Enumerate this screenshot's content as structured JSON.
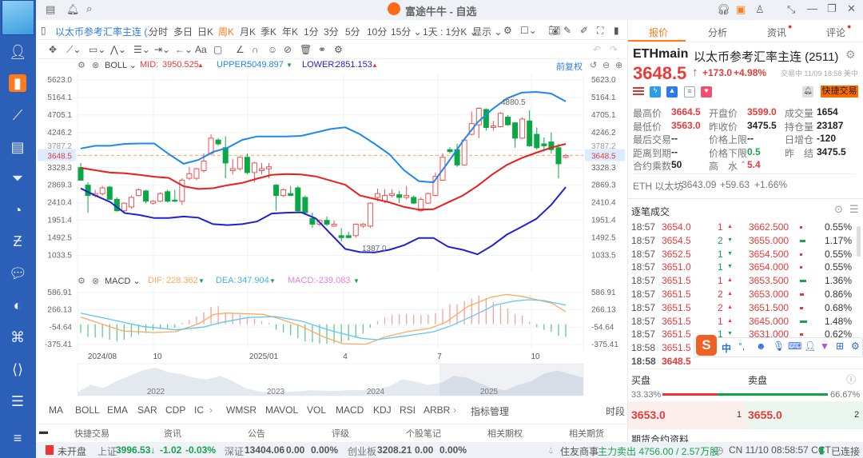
{
  "app": {
    "title": "富途牛牛 - 自选"
  },
  "toolbar1": {
    "symbol": "以太币参考汇率主连 (...",
    "periods": [
      "分时",
      "多日",
      "日K",
      "周K",
      "月K",
      "季K",
      "年K",
      "1分",
      "3分",
      "5分",
      "10分",
      "15分 ⌄",
      "1天 : 1分K ⌄",
      "显示 ⌄"
    ],
    "selected_period": "周K"
  },
  "boll": {
    "name": "BOLL ⌄",
    "mid_label": "MID:",
    "mid": "3950.525",
    "upper_label": "UPPER:",
    "upper": "5049.897",
    "lower_label": "LOWER:",
    "lower": "2851.153",
    "adjust": "前复权"
  },
  "macd": {
    "name": "MACD ⌄",
    "dif_label": "DIF:",
    "dif": "228.362",
    "dea_label": "DEA:",
    "dea": "347.904",
    "macd_label": "MACD:",
    "macd": "-239.083"
  },
  "colors": {
    "up": "#f05050",
    "down": "#0aa845",
    "mid": "#ee1c1c",
    "upper": "#1e88f0",
    "lower": "#1f1fd8",
    "dif": "#ffa85a",
    "dea": "#5ec8f0",
    "accent": "#ff7a1a"
  },
  "chart_data": [
    {
      "type": "candlestick",
      "title": "ETHmain 周K BOLL",
      "y_ticks": [
        "5623.0",
        "5164.1",
        "4705.1",
        "4246.2",
        "3787.2",
        "3328.3",
        "2869.3",
        "2410.4",
        "1951.4",
        "1492.5",
        "1033.5"
      ],
      "ylim": [
        1033.5,
        5623.0
      ],
      "current_price": "3648.5",
      "high_mark": "4880.5",
      "low_mark": "1387.0",
      "ohlc": [
        [
          3330,
          3450,
          2990,
          3000
        ],
        [
          2870,
          2950,
          2150,
          2600
        ],
        [
          2600,
          2750,
          2550,
          2650
        ],
        [
          2650,
          2850,
          2600,
          2800
        ],
        [
          2820,
          2850,
          2480,
          2500
        ],
        [
          2500,
          2550,
          2180,
          2200
        ],
        [
          2200,
          2420,
          2150,
          2400
        ],
        [
          2300,
          2600,
          2250,
          2550
        ],
        [
          2600,
          2780,
          2580,
          2750
        ],
        [
          2720,
          2750,
          2400,
          2450
        ],
        [
          2400,
          2480,
          2360,
          2450
        ],
        [
          2450,
          2680,
          2430,
          2650
        ],
        [
          2700,
          2750,
          2420,
          2450
        ],
        [
          2480,
          2750,
          2430,
          2450
        ],
        [
          2450,
          3050,
          2350,
          3000
        ],
        [
          3050,
          3350,
          3000,
          3170
        ],
        [
          3050,
          3320,
          3000,
          3300
        ],
        [
          3250,
          3700,
          3200,
          3500
        ],
        [
          3700,
          4200,
          3650,
          4100
        ],
        [
          4050,
          4100,
          3900,
          3950
        ],
        [
          3850,
          4150,
          3050,
          3450
        ],
        [
          3250,
          3550,
          3150,
          3300
        ],
        [
          3300,
          3620,
          3250,
          3600
        ],
        [
          3600,
          3700,
          3150,
          3200
        ],
        [
          3200,
          3480,
          2950,
          3450
        ],
        [
          3250,
          3450,
          3150,
          3300
        ],
        [
          3300,
          3450,
          3050,
          3350
        ],
        [
          2870,
          2900,
          2200,
          2600
        ],
        [
          2600,
          2780,
          2560,
          2750
        ],
        [
          2650,
          2850,
          2600,
          2600
        ],
        [
          2800,
          2850,
          2150,
          2200
        ],
        [
          2550,
          2600,
          2100,
          2150
        ],
        [
          2000,
          2150,
          1750,
          1850
        ],
        [
          1850,
          1970,
          1800,
          1950
        ],
        [
          1950,
          2050,
          1800,
          1850
        ],
        [
          1800,
          1950,
          1780,
          1850
        ],
        [
          1550,
          1750,
          1400,
          1500
        ],
        [
          1550,
          1650,
          1480,
          1500
        ],
        [
          1550,
          1870,
          1500,
          1850
        ],
        [
          1800,
          1880,
          1750,
          1850
        ],
        [
          1800,
          2420,
          1750,
          2400
        ],
        [
          2550,
          2780,
          2450,
          2650
        ],
        [
          2450,
          2760,
          2400,
          2600
        ],
        [
          2600,
          2760,
          2550,
          2650
        ],
        [
          2620,
          2720,
          2400,
          2550
        ],
        [
          2550,
          2850,
          2500,
          2600
        ],
        [
          2550,
          2600,
          2380,
          2400
        ],
        [
          2200,
          2550,
          2180,
          2500
        ],
        [
          2400,
          2680,
          2380,
          2650
        ],
        [
          2600,
          3200,
          2580,
          3100
        ],
        [
          3000,
          3700,
          2980,
          3600
        ],
        [
          3800,
          3860,
          3700,
          3750
        ],
        [
          3800,
          3950,
          3350,
          3400
        ],
        [
          3400,
          4100,
          3380,
          4050
        ],
        [
          4200,
          4800,
          4180,
          4480
        ],
        [
          4450,
          4900,
          4100,
          4880
        ],
        [
          4850,
          4880,
          4300,
          4380
        ],
        [
          4380,
          4550,
          4300,
          4420
        ],
        [
          4400,
          4780,
          4380,
          4750
        ],
        [
          4650,
          4700,
          4430,
          4450
        ],
        [
          4500,
          4520,
          3850,
          4100
        ],
        [
          4100,
          4650,
          4080,
          4600
        ],
        [
          4550,
          4830,
          3870,
          3900
        ],
        [
          4200,
          4380,
          3800,
          3850
        ],
        [
          3950,
          4120,
          3750,
          3900
        ],
        [
          4000,
          4250,
          3700,
          3800
        ],
        [
          3850,
          3950,
          3050,
          3430
        ],
        [
          3600,
          3680,
          3560,
          3648
        ]
      ],
      "series": [
        {
          "name": "UPPER",
          "values": [
            3830,
            3900,
            3900,
            3950,
            3960,
            3960,
            3680,
            3430,
            3530,
            3740,
            3850,
            4055,
            4145,
            4145,
            4145,
            4160,
            4250,
            4340,
            4383,
            4202,
            3950,
            3679,
            3260,
            2975,
            2945,
            3470,
            4020,
            4515,
            4856,
            5140,
            5290,
            5310,
            5268,
            5060
          ]
        },
        {
          "name": "MID",
          "values": [
            3323,
            3260,
            3200,
            3180,
            3140,
            3090,
            3060,
            2840,
            2770,
            2790,
            2870,
            2930,
            3040,
            3140,
            3160,
            3150,
            3100,
            2990,
            2880,
            2600,
            2510,
            2420,
            2300,
            2230,
            2240,
            2420,
            2600,
            2850,
            3150,
            3400,
            3580,
            3720,
            3850,
            3950
          ]
        },
        {
          "name": "LOWER",
          "values": [
            2786,
            2600,
            2430,
            2140,
            2090,
            2010,
            2010,
            2050,
            2020,
            1850,
            1825,
            1850,
            1920,
            2130,
            2150,
            2160,
            2000,
            1600,
            1200,
            1120,
            1110,
            1180,
            1300,
            1490,
            1490,
            1260,
            1180,
            1060,
            1290,
            1580,
            1780,
            1990,
            2350,
            2820
          ]
        }
      ]
    },
    {
      "type": "bar+line",
      "title": "MACD",
      "y_ticks": [
        "586.91",
        "266.13",
        "-54.64",
        "-375.41"
      ],
      "ylim": [
        -375.41,
        586.91
      ],
      "histogram": [
        -163,
        -237,
        -247,
        -247,
        -286,
        -311,
        -286,
        -237,
        -187,
        -163,
        -113,
        -89,
        -74,
        -64,
        25,
        84,
        143,
        222,
        320,
        340,
        207,
        197,
        173,
        133,
        104,
        59,
        25,
        -104,
        -153,
        -202,
        -261,
        -320,
        -335,
        -360,
        -360,
        -350,
        -335,
        -301,
        -250,
        -173,
        -64,
        59,
        123,
        173,
        182,
        192,
        173,
        168,
        182,
        207,
        281,
        370,
        370,
        429,
        478,
        528,
        488,
        404,
        355,
        291,
        192,
        158,
        44,
        -54,
        -104,
        -138,
        -212,
        -237
      ],
      "dif": [
        [
          0,
          133
        ],
        [
          2.2,
          35
        ],
        [
          5.8,
          -123
        ],
        [
          10,
          -153
        ],
        [
          13.1,
          -138
        ],
        [
          16.3,
          10
        ],
        [
          18.4,
          182
        ],
        [
          20,
          207
        ],
        [
          22.1,
          197
        ],
        [
          25.2,
          182
        ],
        [
          27.3,
          108
        ],
        [
          30.5,
          -39
        ],
        [
          33.6,
          -236
        ],
        [
          36.2,
          -360
        ],
        [
          39.4,
          -370
        ],
        [
          42,
          -236
        ],
        [
          45.1,
          -138
        ],
        [
          48.3,
          -74
        ],
        [
          50.4,
          35
        ],
        [
          53.5,
          330
        ],
        [
          56.7,
          503
        ],
        [
          58.8,
          552
        ],
        [
          60.9,
          518
        ],
        [
          63,
          453
        ],
        [
          65.1,
          389
        ],
        [
          67,
          232
        ]
      ],
      "dea": [
        [
          0,
          207
        ],
        [
          4.3,
          84
        ],
        [
          8.5,
          -39
        ],
        [
          13.1,
          -104
        ],
        [
          16.9,
          -54
        ],
        [
          19.5,
          35
        ],
        [
          23.1,
          123
        ],
        [
          26.8,
          143
        ],
        [
          30.5,
          59
        ],
        [
          34.7,
          -123
        ],
        [
          38.8,
          -261
        ],
        [
          40.9,
          -286
        ],
        [
          45.1,
          -212
        ],
        [
          48.8,
          -138
        ],
        [
          51.4,
          -15
        ],
        [
          54.6,
          182
        ],
        [
          57.2,
          355
        ],
        [
          59.8,
          429
        ],
        [
          61.9,
          453
        ],
        [
          64,
          438
        ],
        [
          67,
          355
        ]
      ],
      "x_labels": [
        "2024/08",
        "10",
        "2025/01",
        "4",
        "7",
        "10"
      ]
    },
    {
      "type": "area",
      "title": "navigator",
      "x_labels": [
        "2022",
        "2023",
        "2024",
        "2025"
      ],
      "values": [
        10,
        30,
        22,
        40,
        55,
        70,
        78,
        65,
        60,
        50,
        45,
        55,
        40,
        20,
        12,
        8,
        10,
        12,
        15,
        14,
        13,
        16,
        15,
        18,
        25,
        45,
        40,
        30,
        35,
        55,
        50,
        35,
        20,
        15,
        30,
        40,
        62,
        70,
        60,
        50
      ]
    }
  ],
  "indicators": {
    "main": [
      "MA",
      "BOLL",
      "EMA",
      "SAR",
      "CDP",
      "IC"
    ],
    "sub": [
      "WMSR",
      "MAVOL",
      "VOL",
      "MACD",
      "KDJ",
      "RSI",
      "ARBR"
    ],
    "manage": "指标管理",
    "period": "时段",
    "selected_main": "BOLL",
    "selected_sub": "MACD"
  },
  "bottom_tabs": [
    "快捷交易",
    "资讯",
    "公告",
    "评级",
    "个股笔记",
    "相关期权",
    "相关期货"
  ],
  "right": {
    "tabs": [
      "报价",
      "分析",
      "资讯",
      "评论"
    ],
    "code": "ETHmain",
    "name": "以太币参考汇率主连 (2511)",
    "price": "3648.5",
    "change": "+173.0",
    "change_pct": "+4.98%",
    "trade_status": "交易中 11/09 18:58 美中",
    "quick_trade": "快捷交易",
    "stats": [
      {
        "label": "最高价",
        "value": "3664.5",
        "color": "red"
      },
      {
        "label": "开盘价",
        "value": "3599.0",
        "color": "red"
      },
      {
        "label": "成交量",
        "value": "1654",
        "color": "dark"
      },
      {
        "label": "最低价",
        "value": "3563.0",
        "color": "red"
      },
      {
        "label": "昨收价",
        "value": "3475.5",
        "color": "dark"
      },
      {
        "label": "持仓量",
        "value": "23187",
        "color": "dark"
      },
      {
        "label": "最后交易",
        "value": "--",
        "color": "dark"
      },
      {
        "label": "价格上限",
        "value": "--",
        "color": "dark"
      },
      {
        "label": "日增仓",
        "value": "-120",
        "color": "dark"
      },
      {
        "label": "距离到期",
        "value": "--",
        "color": "dark"
      },
      {
        "label": "价格下限",
        "value": "0.5",
        "color": "green"
      },
      {
        "label": "昨　结",
        "value": "3475.5",
        "color": "dark"
      },
      {
        "label": "合约乘数",
        "value": "50",
        "color": "dark"
      },
      {
        "label": "高　水",
        "value": "5.4",
        "color": "red"
      }
    ],
    "underlying": {
      "name": "ETH 以太坊",
      "price": "3643.09",
      "change": "+59.63",
      "pct": "+1.66%"
    },
    "ticks_title": "逐笔成交",
    "ticks": [
      {
        "time": "18:57",
        "price": "3654.0",
        "vol": "1",
        "dir": "up",
        "price2": "3662.500",
        "pct": "0.55%"
      },
      {
        "time": "18:57",
        "price": "3654.5",
        "vol": "2",
        "dir": "down",
        "price2": "3655.000",
        "pct": "1.17%"
      },
      {
        "time": "18:57",
        "price": "3652.5",
        "vol": "1",
        "dir": "down",
        "price2": "3654.500",
        "pct": "0.55%"
      },
      {
        "time": "18:57",
        "price": "3651.0",
        "vol": "1",
        "dir": "down",
        "price2": "3654.000",
        "pct": "0.55%"
      },
      {
        "time": "18:57",
        "price": "3651.5",
        "vol": "1",
        "dir": "up",
        "price2": "3653.500",
        "pct": "1.36%"
      },
      {
        "time": "18:57",
        "price": "3651.5",
        "vol": "2",
        "dir": "up",
        "price2": "3653.000",
        "pct": "0.86%"
      },
      {
        "time": "18:57",
        "price": "3651.5",
        "vol": "2",
        "dir": "up",
        "price2": "3651.500",
        "pct": "0.68%"
      },
      {
        "time": "18:57",
        "price": "3651.5",
        "vol": "1",
        "dir": "up",
        "price2": "3645.000",
        "pct": "1.48%"
      },
      {
        "time": "18:57",
        "price": "3651.5",
        "vol": "1",
        "dir": "down",
        "price2": "3631.000",
        "pct": "0.62%"
      },
      {
        "time": "18:58",
        "price": "3651.5",
        "vol": "",
        "dir": "",
        "price2": "",
        "pct": ""
      },
      {
        "time": "18:58",
        "price": "3648.5",
        "vol": "",
        "dir": "",
        "price2": "",
        "pct": ""
      }
    ],
    "ime": {
      "label": "中",
      "punct": "°,"
    },
    "orderbook": {
      "bid_label": "买盘",
      "ask_label": "卖盘",
      "bid_pct": "33.33%",
      "ask_pct": "66.67%",
      "bid_ratio": 0.3333,
      "bid_price": "3653.0",
      "bid_qty": "1",
      "ask_price": "3655.0",
      "ask_qty": "2"
    },
    "contract_info": "期货合约资料"
  },
  "status": {
    "market": "未开盘",
    "sh_label": "上证",
    "sh": "3996.53↓",
    "sh_chg": "-1.02",
    "sh_pct": "-0.03%",
    "sz_label": "深证",
    "sz": "13404.06",
    "sz_chg": "0.00",
    "sz_pct": "0.00%",
    "cy_label": "创业板",
    "cy": "3208.21",
    "cy_chg": "0.00",
    "cy_pct": "0.00%",
    "news": "住友商事",
    "flow": "主力卖出 4756.00 / 2.57万股",
    "clock": "CN 11/10 08:58:57 CCT",
    "conn": "已连接"
  }
}
